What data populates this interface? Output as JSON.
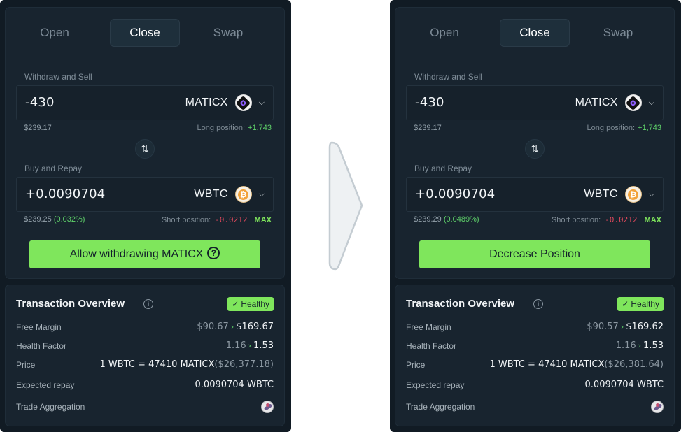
{
  "panels": [
    {
      "tabs": [
        "Open",
        "Close",
        "Swap"
      ],
      "active_tab": "Close",
      "withdraw": {
        "label": "Withdraw and Sell",
        "amount": "-430",
        "token": "MATICX",
        "usd": "$239.17",
        "position_label": "Long position:",
        "position_value": "+1,743"
      },
      "buy": {
        "label": "Buy and Repay",
        "amount": "+0.0090704",
        "token": "WBTC",
        "usd": "$239.25",
        "usd_pct": "(0.032%)",
        "position_label": "Short position:",
        "position_value": "-0.0212",
        "max_label": "MAX"
      },
      "cta_label": "Allow withdrawing MATICX",
      "cta_help": "?",
      "overview": {
        "title": "Transaction Overview",
        "status": "Healthy",
        "free_margin_label": "Free Margin",
        "free_margin_old": "$90.67",
        "free_margin_new": "$169.67",
        "health_factor_label": "Health Factor",
        "health_factor_old": "1.16",
        "health_factor_new": "1.53",
        "price_label": "Price",
        "price_value": "1 WBTC = 47410 MATICX",
        "price_usd": "($26,377.18)",
        "repay_label": "Expected repay",
        "repay_value": "0.0090704 WBTC",
        "aggregation_label": "Trade Aggregation"
      }
    },
    {
      "tabs": [
        "Open",
        "Close",
        "Swap"
      ],
      "active_tab": "Close",
      "withdraw": {
        "label": "Withdraw and Sell",
        "amount": "-430",
        "token": "MATICX",
        "usd": "$239.17",
        "position_label": "Long position:",
        "position_value": "+1,743"
      },
      "buy": {
        "label": "Buy and Repay",
        "amount": "+0.0090704",
        "token": "WBTC",
        "usd": "$239.29",
        "usd_pct": "(0.0489%)",
        "position_label": "Short position:",
        "position_value": "-0.0212",
        "max_label": "MAX"
      },
      "cta_label": "Decrease Position",
      "overview": {
        "title": "Transaction Overview",
        "status": "Healthy",
        "free_margin_label": "Free Margin",
        "free_margin_old": "$90.57",
        "free_margin_new": "$169.62",
        "health_factor_label": "Health Factor",
        "health_factor_old": "1.16",
        "health_factor_new": "1.53",
        "price_label": "Price",
        "price_value": "1 WBTC = 47410 MATICX",
        "price_usd": "($26,381.64)",
        "repay_label": "Expected repay",
        "repay_value": "0.0090704 WBTC",
        "aggregation_label": "Trade Aggregation"
      }
    }
  ],
  "icons": {
    "swap": "swap-vertical-icon",
    "chevron": "chevron-down-icon",
    "arrow": "arrow-right-icon",
    "info": "info-icon",
    "check": "check-icon",
    "matic_token": "maticx-token-icon",
    "wbtc_token": "wbtc-token-icon",
    "aggregator": "aggregator-logo-icon"
  },
  "colors": {
    "accent": "#7fe65c",
    "panel_bg": "#111b24",
    "card_bg": "#18242f",
    "positive": "#5fd36a",
    "negative": "#e2485c"
  }
}
